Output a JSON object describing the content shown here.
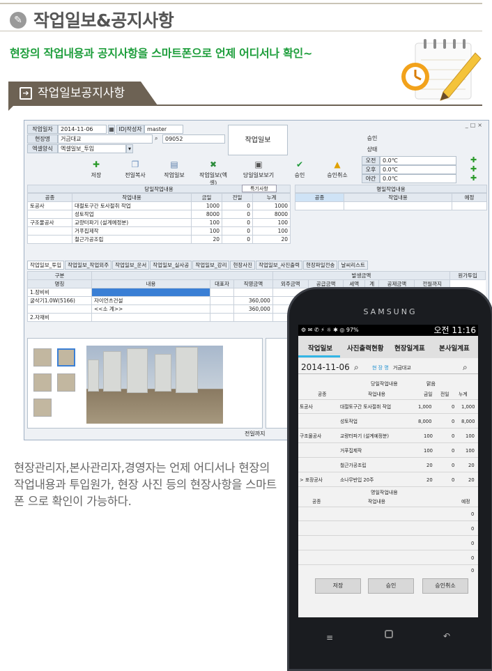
{
  "header": {
    "title": "작업일보&공지사항",
    "subtitle": "현장의 작업내용과 공지사항을 스마트폰으로 언제 어디서나 확인~",
    "section_tab": "작업일보공지사항"
  },
  "desktop": {
    "form": {
      "work_date_label": "작업일자",
      "work_date": "2014-11-06",
      "id_label": "ID|작성자",
      "id_value": "master",
      "site_label": "현장명",
      "site_value": "거금대교",
      "site_code": "09052",
      "excel_label": "엑셀양식",
      "excel_value": "엑셀일보_투입",
      "form_title": "작업일보",
      "approve_label": "승인",
      "status_label": "상태",
      "am_label": "오전",
      "am_temp": "0.0℃",
      "pm_label": "오후",
      "pm_temp": "0.0℃",
      "night_label": "야간",
      "night_temp": "0.0℃"
    },
    "toolbar": [
      "저장",
      "전일복사",
      "작업일보",
      "작업일보(엑셀)",
      "당일일보보기",
      "승인",
      "승인취소"
    ],
    "today_work": {
      "title": "당일작업내용",
      "special_btn": "특기사항",
      "headers": [
        "공종",
        "작업내용",
        "금일",
        "전일",
        "누계"
      ],
      "rows": [
        [
          "토공사",
          "대절토구간 토사절취 작업",
          "1000",
          "0",
          "1000"
        ],
        [
          "",
          "성토작업",
          "8000",
          "0",
          "8000"
        ],
        [
          "구조물공사",
          "교량터파기 (설계예정분)",
          "100",
          "0",
          "100"
        ],
        [
          "",
          "거푸집제작",
          "100",
          "0",
          "100"
        ],
        [
          "",
          "철근가공조립",
          "20",
          "0",
          "20"
        ]
      ]
    },
    "tomorrow_work": {
      "title": "명일작업내용",
      "headers": [
        "공종",
        "작업내용",
        "예정"
      ]
    },
    "tabs": [
      "작업일보_투입",
      "작업일보_작업외주",
      "작업일보_운서",
      "작업일보_실사공",
      "작업일보_강리",
      "현장사진",
      "작업일보_사진출력",
      "현장파일전송",
      "날씨리스트"
    ],
    "cost_table": {
      "group_header": "발생금액",
      "col_headers": [
        "구분",
        "명칭",
        "내용",
        "대표자",
        "직영금액",
        "외주금액",
        "공급금액",
        "세액",
        "계",
        "공제금액"
      ],
      "right_header": "원가투입",
      "right_sub": "전월까지",
      "rows": [
        [
          "1.장비비",
          "",
          "",
          "",
          ""
        ],
        [
          "굴삭기1.0W(5166)",
          "자이언츠건설",
          "",
          "360,000",
          ""
        ],
        [
          "",
          "<<소 계>>",
          "",
          "360,000",
          ""
        ],
        [
          "2.자재비",
          "",
          "",
          "",
          ""
        ]
      ]
    },
    "footer_label": "전일까지"
  },
  "phone": {
    "brand": "SAMSUNG",
    "status_left": "97%",
    "status_time": "오전 11:16",
    "tabs": [
      "작업일보",
      "사진출력현황",
      "현장일계표",
      "본사일계표"
    ],
    "date": "2014-11-06",
    "site_label": "현 장 명",
    "site_value": "거금대교",
    "today_title": "당일작업내용",
    "weather": "맑음",
    "headers": [
      "공종",
      "작업내용",
      "금일",
      "전일",
      "누계"
    ],
    "rows": [
      [
        "토공사",
        "대절토구간 토사절취 작업",
        "1,000",
        "0",
        "1,000"
      ],
      [
        "",
        "성토작업",
        "8,000",
        "0",
        "8,000"
      ],
      [
        "구조물공사",
        "교량터파기 (설계예정분)",
        "100",
        "0",
        "100"
      ],
      [
        "",
        "거푸집제작",
        "100",
        "0",
        "100"
      ],
      [
        "",
        "철근가공조립",
        "20",
        "0",
        "20"
      ],
      [
        "> 포장공사",
        "소나무반입 20주",
        "20",
        "0",
        "20"
      ]
    ],
    "tomorrow_title": "명일작업내용",
    "tomorrow_headers": [
      "공종",
      "작업내용",
      "예정"
    ],
    "tomorrow_rows": [
      "0",
      "0",
      "0",
      "0",
      "0"
    ],
    "buttons": [
      "저장",
      "승인",
      "승인취소"
    ]
  },
  "description": "현장관리자,본사관리자,경영자는 언제 어디서나 현장의 작업내용과 투입원가, 현장 사진 등의 현장사항을 스마트폰 으로 확인이 가능하다."
}
